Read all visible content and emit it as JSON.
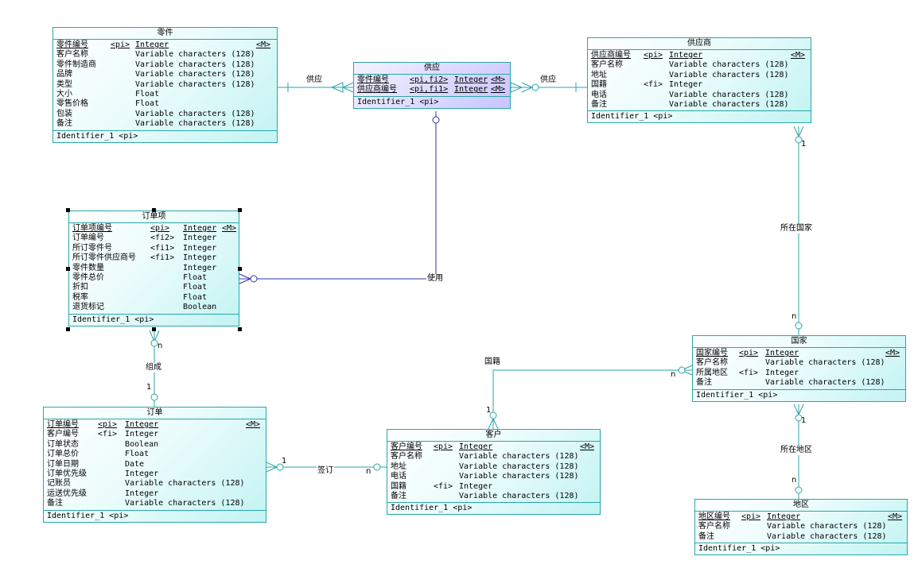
{
  "entities": {
    "part": {
      "title": "零件",
      "attrs": [
        {
          "name": "零件编号",
          "key": "<pi>",
          "type": "Integer",
          "mand": "<M>",
          "pk": true
        },
        {
          "name": "客户名称",
          "key": "",
          "type": "Variable characters (128)",
          "mand": ""
        },
        {
          "name": "零件制造商",
          "key": "",
          "type": "Variable characters (128)",
          "mand": ""
        },
        {
          "name": "品牌",
          "key": "",
          "type": "Variable characters (128)",
          "mand": ""
        },
        {
          "name": "类型",
          "key": "",
          "type": "Variable characters (128)",
          "mand": ""
        },
        {
          "name": "大小",
          "key": "",
          "type": "Float",
          "mand": ""
        },
        {
          "name": "零售价格",
          "key": "",
          "type": "Float",
          "mand": ""
        },
        {
          "name": "包装",
          "key": "",
          "type": "Variable characters (128)",
          "mand": ""
        },
        {
          "name": "备注",
          "key": "",
          "type": "Variable characters (128)",
          "mand": ""
        }
      ],
      "identifier": "Identifier_1 <pi>"
    },
    "supply": {
      "title": "供应",
      "attrs": [
        {
          "name": "零件编号",
          "key": "<pi,fi2>",
          "type": "Integer",
          "mand": "<M>",
          "pk": true
        },
        {
          "name": "供应商编号",
          "key": "<pi,fi1>",
          "type": "Integer",
          "mand": "<M>",
          "pk": true
        }
      ],
      "identifier": "Identifier_1 <pi>"
    },
    "supplier": {
      "title": "供应商",
      "attrs": [
        {
          "name": "供应商编号",
          "key": "<pi>",
          "type": "Integer",
          "mand": "<M>",
          "pk": true
        },
        {
          "name": "客户名称",
          "key": "",
          "type": "Variable characters (128)",
          "mand": ""
        },
        {
          "name": "地址",
          "key": "",
          "type": "Variable characters (128)",
          "mand": ""
        },
        {
          "name": "国籍",
          "key": "<fi>",
          "type": "Integer",
          "mand": ""
        },
        {
          "name": "电话",
          "key": "",
          "type": "Variable characters (128)",
          "mand": ""
        },
        {
          "name": "备注",
          "key": "",
          "type": "Variable characters (128)",
          "mand": ""
        }
      ],
      "identifier": "Identifier_1 <pi>"
    },
    "orderitem": {
      "title": "订单项",
      "attrs": [
        {
          "name": "订单项编号",
          "key": "<pi>",
          "type": "Integer",
          "mand": "<M>",
          "pk": true
        },
        {
          "name": "订单编号",
          "key": "<fi2>",
          "type": "Integer",
          "mand": ""
        },
        {
          "name": "所订零件号",
          "key": "<fi1>",
          "type": "Integer",
          "mand": ""
        },
        {
          "name": "所订零件供应商号",
          "key": "<fi1>",
          "type": "Integer",
          "mand": ""
        },
        {
          "name": "零件数量",
          "key": "",
          "type": "Integer",
          "mand": ""
        },
        {
          "name": "零件总价",
          "key": "",
          "type": "Float",
          "mand": ""
        },
        {
          "name": "折扣",
          "key": "",
          "type": "Float",
          "mand": ""
        },
        {
          "name": "税率",
          "key": "",
          "type": "Float",
          "mand": ""
        },
        {
          "name": "退货标记",
          "key": "",
          "type": "Boolean",
          "mand": ""
        }
      ],
      "identifier": "Identifier_1 <pi>"
    },
    "country": {
      "title": "国家",
      "attrs": [
        {
          "name": "国家编号",
          "key": "<pi>",
          "type": "Integer",
          "mand": "<M>",
          "pk": true
        },
        {
          "name": "客户名称",
          "key": "",
          "type": "Variable characters (128)",
          "mand": ""
        },
        {
          "name": "所属地区",
          "key": "<fi>",
          "type": "Integer",
          "mand": ""
        },
        {
          "name": "备注",
          "key": "",
          "type": "Variable characters (128)",
          "mand": ""
        }
      ],
      "identifier": "Identifier_1 <pi>"
    },
    "order": {
      "title": "订单",
      "attrs": [
        {
          "name": "订单编号",
          "key": "<pi>",
          "type": "Integer",
          "mand": "<M>",
          "pk": true
        },
        {
          "name": "客户编号",
          "key": "<fi>",
          "type": "Integer",
          "mand": ""
        },
        {
          "name": "订单状态",
          "key": "",
          "type": "Boolean",
          "mand": ""
        },
        {
          "name": "订单总价",
          "key": "",
          "type": "Float",
          "mand": ""
        },
        {
          "name": "订单日期",
          "key": "",
          "type": "Date",
          "mand": ""
        },
        {
          "name": "订单优先级",
          "key": "",
          "type": "Integer",
          "mand": ""
        },
        {
          "name": "记账员",
          "key": "",
          "type": "Variable characters (128)",
          "mand": ""
        },
        {
          "name": "运送优先级",
          "key": "",
          "type": "Integer",
          "mand": ""
        },
        {
          "name": "备注",
          "key": "",
          "type": "Variable characters (128)",
          "mand": ""
        }
      ],
      "identifier": "Identifier_1 <pi>"
    },
    "customer": {
      "title": "客户",
      "attrs": [
        {
          "name": "客户编号",
          "key": "<pi>",
          "type": "Integer",
          "mand": "<M>",
          "pk": true
        },
        {
          "name": "客户名称",
          "key": "",
          "type": "Variable characters (128)",
          "mand": ""
        },
        {
          "name": "地址",
          "key": "",
          "type": "Variable characters (128)",
          "mand": ""
        },
        {
          "name": "电话",
          "key": "",
          "type": "Variable characters (128)",
          "mand": ""
        },
        {
          "name": "国籍",
          "key": "<fi>",
          "type": "Integer",
          "mand": ""
        },
        {
          "name": "备注",
          "key": "",
          "type": "Variable characters (128)",
          "mand": ""
        }
      ],
      "identifier": "Identifier_1 <pi>"
    },
    "region": {
      "title": "地区",
      "attrs": [
        {
          "name": "地区编号",
          "key": "<pi>",
          "type": "Integer",
          "mand": "<M>",
          "pk": true
        },
        {
          "name": "客户名称",
          "key": "",
          "type": "Variable characters (128)",
          "mand": ""
        },
        {
          "name": "备注",
          "key": "",
          "type": "Variable characters (128)",
          "mand": ""
        }
      ],
      "identifier": "Identifier_1 <pi>"
    }
  },
  "relationships": {
    "supply_left": {
      "label": "供应"
    },
    "supply_right": {
      "label": "供应"
    },
    "use": {
      "label": "使用"
    },
    "compose": {
      "label": "组成",
      "card_top": "n",
      "card_bottom": "1"
    },
    "sign": {
      "label": "签订",
      "card_left": "1",
      "card_right": "n"
    },
    "nationality": {
      "label": "国籍",
      "card_top": "1",
      "card_right": "n"
    },
    "in_country": {
      "label": "所在国家",
      "card_top": "1",
      "card_bottom": "n"
    },
    "in_region": {
      "label": "所在地区",
      "card_top": "1",
      "card_bottom": "n"
    }
  },
  "colors": {
    "entity_border": "#2aa6a6",
    "line": "#2aa6a6",
    "use_line": "#3333aa",
    "assoc_fill": "#c9c4ff"
  }
}
